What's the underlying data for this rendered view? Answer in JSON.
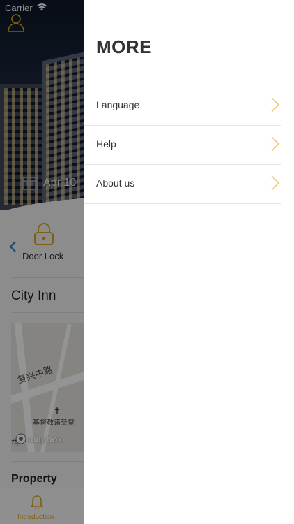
{
  "status_bar": {
    "carrier": "Carrier"
  },
  "background": {
    "date_text": "Apr 10",
    "door_lock_label": "Door Lock",
    "hotel_name": "City Inn",
    "map": {
      "road_label": "复兴中路",
      "church_label": "基督教诸圣堂",
      "left_label": "花",
      "mapbox_label": "mapbox"
    },
    "property_title": "Property",
    "tab_label": "Introduction"
  },
  "drawer": {
    "title": "MORE",
    "menu": [
      {
        "label": "Language"
      },
      {
        "label": "Help"
      },
      {
        "label": "About us"
      }
    ]
  },
  "colors": {
    "accent": "#e8c170",
    "overlay": "#000000",
    "text_dark": "#333333"
  },
  "icons": {
    "menu_chevron": "chevron-right-icon",
    "profile": "person-icon",
    "lock": "padlock-icon",
    "tab": "bell-icon"
  }
}
